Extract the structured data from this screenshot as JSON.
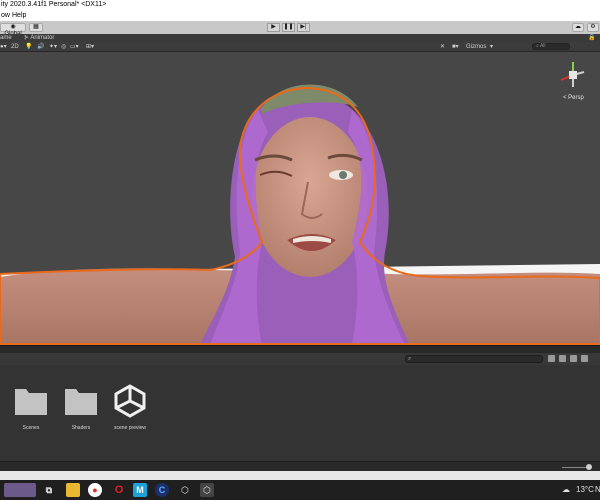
{
  "window": {
    "title": "ity 2020.3.41f1 Personal* <DX11>"
  },
  "menu": {
    "items": [
      "ow",
      "Help"
    ]
  },
  "toolbar": {
    "global_label": "Global"
  },
  "scene_tabs": {
    "game": "ame",
    "animator": "Animator"
  },
  "scene_tools": {
    "mode_2d": "2D",
    "gizmos": "Gizmos",
    "search_placeholder": "All"
  },
  "viewport": {
    "persp_label": "< Persp"
  },
  "assets": [
    {
      "name": "Scenes",
      "icon": "folder-icon"
    },
    {
      "name": "Shaders",
      "icon": "folder-icon"
    },
    {
      "name": "scene preview",
      "icon": "unity-logo-icon"
    }
  ],
  "tray": {
    "temperature": "13°C",
    "extra": "N"
  },
  "colors": {
    "selection_outline": "#e86a1a",
    "hair": "#b06ad2",
    "viewport_bg": "#474747"
  }
}
